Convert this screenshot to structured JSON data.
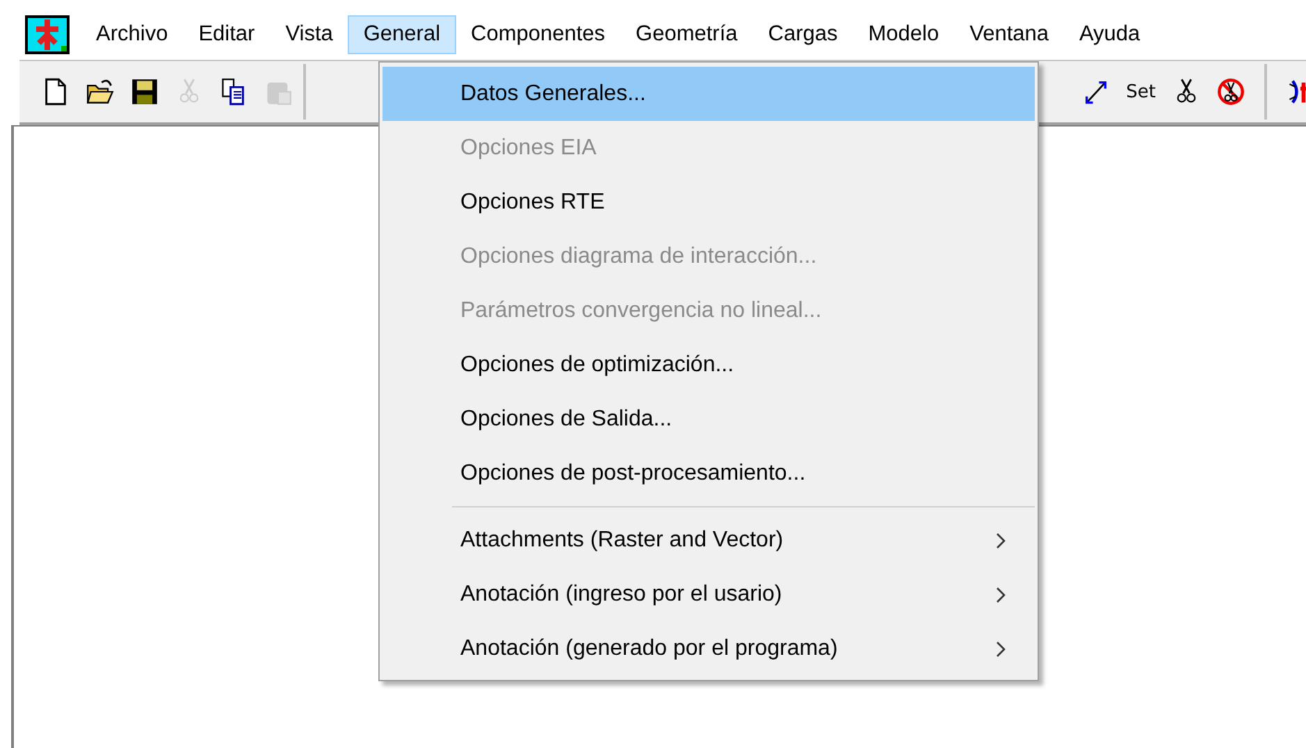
{
  "menubar": {
    "items": [
      {
        "label": "Archivo",
        "selected": false
      },
      {
        "label": "Editar",
        "selected": false
      },
      {
        "label": "Vista",
        "selected": false
      },
      {
        "label": "General",
        "selected": true
      },
      {
        "label": "Componentes",
        "selected": false
      },
      {
        "label": "Geometría",
        "selected": false
      },
      {
        "label": "Cargas",
        "selected": false
      },
      {
        "label": "Modelo",
        "selected": false
      },
      {
        "label": "Ventana",
        "selected": false
      },
      {
        "label": "Ayuda",
        "selected": false
      }
    ]
  },
  "toolbar": {
    "left": [
      {
        "kind": "new",
        "disabled": false
      },
      {
        "kind": "open",
        "disabled": false
      },
      {
        "kind": "save",
        "disabled": false
      },
      {
        "kind": "cut",
        "disabled": true
      },
      {
        "kind": "copy",
        "disabled": false
      },
      {
        "kind": "paste",
        "disabled": true
      }
    ],
    "right": [
      {
        "kind": "zoom",
        "disabled": false
      },
      {
        "kind": "text",
        "label": "Set",
        "disabled": false
      },
      {
        "kind": "cut",
        "disabled": false
      },
      {
        "kind": "no-cut",
        "disabled": false
      },
      {
        "kind": "separator"
      },
      {
        "kind": "section",
        "disabled": false
      }
    ]
  },
  "menu": {
    "items": [
      {
        "kind": "item",
        "label": "Datos Generales...",
        "selected": true,
        "disabled": false,
        "submenu": false
      },
      {
        "kind": "item",
        "label": "Opciones EIA",
        "selected": false,
        "disabled": true,
        "submenu": false
      },
      {
        "kind": "item",
        "label": "Opciones RTE",
        "selected": false,
        "disabled": false,
        "submenu": false
      },
      {
        "kind": "item",
        "label": "Opciones diagrama de interacción...",
        "selected": false,
        "disabled": true,
        "submenu": false
      },
      {
        "kind": "item",
        "label": "Parámetros convergencia no lineal...",
        "selected": false,
        "disabled": true,
        "submenu": false
      },
      {
        "kind": "item",
        "label": "Opciones de optimización...",
        "selected": false,
        "disabled": false,
        "submenu": false
      },
      {
        "kind": "item",
        "label": "Opciones de Salida...",
        "selected": false,
        "disabled": false,
        "submenu": false
      },
      {
        "kind": "item",
        "label": "Opciones de post-procesamiento...",
        "selected": false,
        "disabled": false,
        "submenu": false
      },
      {
        "kind": "separator"
      },
      {
        "kind": "item",
        "label": "Attachments (Raster and Vector)",
        "selected": false,
        "disabled": false,
        "submenu": true
      },
      {
        "kind": "item",
        "label": "Anotación (ingreso por el usario)",
        "selected": false,
        "disabled": false,
        "submenu": true
      },
      {
        "kind": "item",
        "label": "Anotación (generado por el programa)",
        "selected": false,
        "disabled": false,
        "submenu": true
      }
    ]
  }
}
